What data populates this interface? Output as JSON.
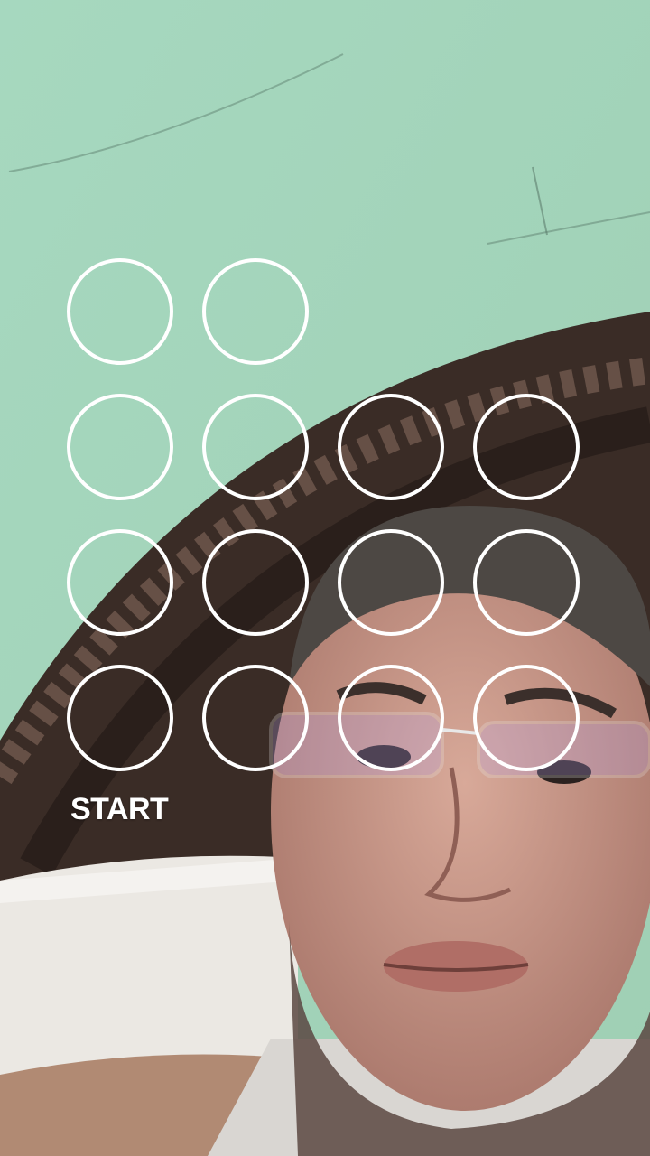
{
  "start_label": "START",
  "colors": {
    "ring": "#ffffff",
    "wall": "#a8d8bd",
    "headboard": "#3a2c26",
    "pillow": "#ebe8e3",
    "skin": "#c9988a"
  },
  "pattern": {
    "rows": 4,
    "columns": 4,
    "empty_slots_in_first_row": 2
  }
}
